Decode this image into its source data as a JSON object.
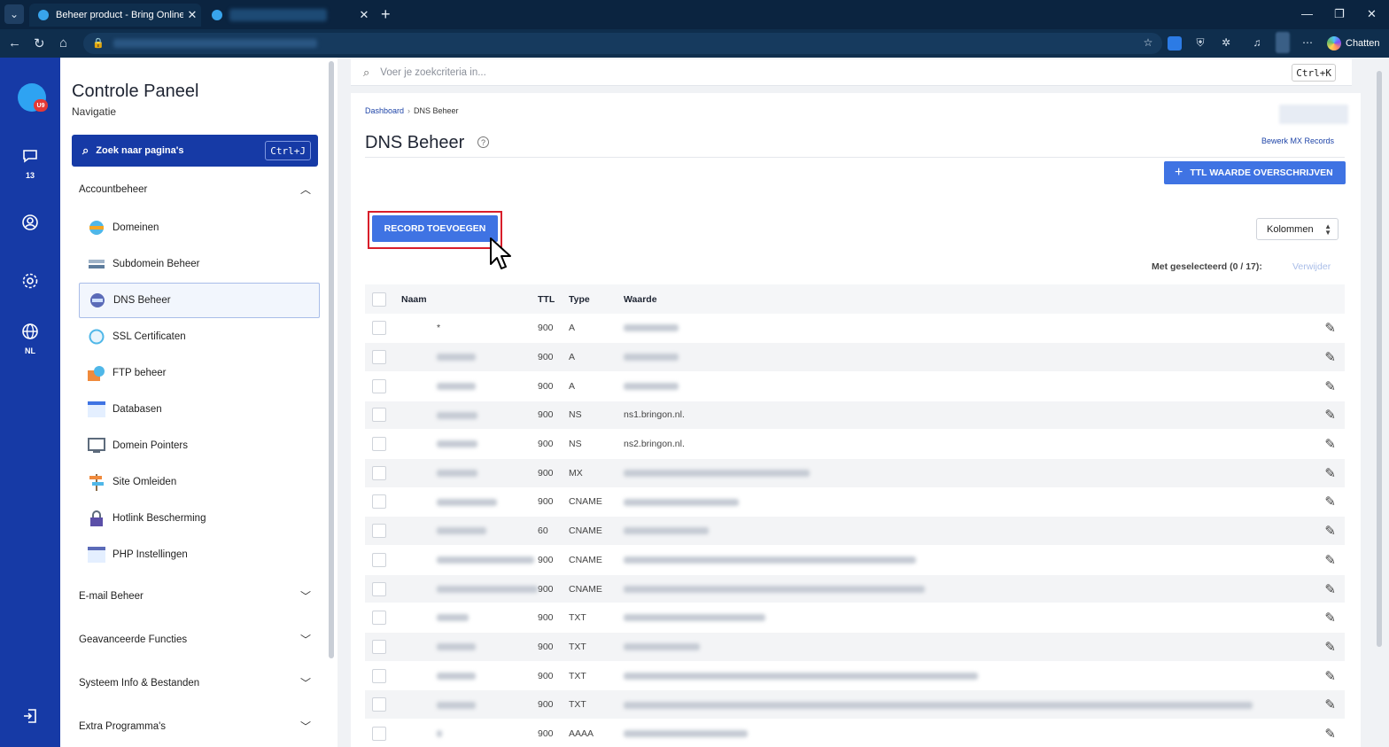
{
  "browser": {
    "active_tab_title": "Beheer product - Bring Online",
    "chatten_label": "Chatten"
  },
  "rail": {
    "badge": "U9",
    "chat_count": "13",
    "language": "NL"
  },
  "sidebar": {
    "title": "Controle Paneel",
    "subtitle": "Navigatie",
    "search_label": "Zoek naar pagina's",
    "search_shortcut": "Ctrl+J",
    "sections": [
      {
        "label": "Accountbeheer",
        "expanded": true
      },
      {
        "label": "E-mail Beheer",
        "expanded": false
      },
      {
        "label": "Geavanceerde Functies",
        "expanded": false
      },
      {
        "label": "Systeem Info & Bestanden",
        "expanded": false
      },
      {
        "label": "Extra Programma's",
        "expanded": false
      }
    ],
    "items": [
      {
        "label": "Domeinen",
        "icon": "globe-icon"
      },
      {
        "label": "Subdomein Beheer",
        "icon": "subdomain-icon"
      },
      {
        "label": "DNS Beheer",
        "icon": "dns-icon",
        "active": true
      },
      {
        "label": "SSL Certificaten",
        "icon": "certificate-icon"
      },
      {
        "label": "FTP beheer",
        "icon": "ftp-icon"
      },
      {
        "label": "Databasen",
        "icon": "database-icon"
      },
      {
        "label": "Domein Pointers",
        "icon": "pointer-icon"
      },
      {
        "label": "Site Omleiden",
        "icon": "signpost-icon"
      },
      {
        "label": "Hotlink Bescherming",
        "icon": "lock-icon"
      },
      {
        "label": "PHP Instellingen",
        "icon": "php-icon"
      }
    ]
  },
  "topsearch": {
    "placeholder": "Voer je zoekcriteria in...",
    "shortcut": "Ctrl+K"
  },
  "page": {
    "breadcrumb_home": "Dashboard",
    "breadcrumb_current": "DNS Beheer",
    "title": "DNS Beheer",
    "mx_link": "Bewerk MX Records",
    "ttl_button": "TTL WAARDE OVERSCHRIJVEN",
    "add_record_button": "RECORD TOEVOEGEN",
    "columns_button": "Kolommen",
    "selected_info": "Met geselecteerd (0 / 17):",
    "delete_link": "Verwijder"
  },
  "table": {
    "headers": {
      "name": "Naam",
      "ttl": "TTL",
      "type": "Type",
      "value": "Waarde"
    },
    "rows": [
      {
        "name": "*",
        "ttl": "900",
        "type": "A",
        "value": ""
      },
      {
        "name": "",
        "ttl": "900",
        "type": "A",
        "value": ""
      },
      {
        "name": "",
        "ttl": "900",
        "type": "A",
        "value": ""
      },
      {
        "name": "",
        "ttl": "900",
        "type": "NS",
        "value": "ns1.bringon.nl."
      },
      {
        "name": "",
        "ttl": "900",
        "type": "NS",
        "value": "ns2.bringon.nl."
      },
      {
        "name": "",
        "ttl": "900",
        "type": "MX",
        "value": ""
      },
      {
        "name": "",
        "ttl": "900",
        "type": "CNAME",
        "value": ""
      },
      {
        "name": "",
        "ttl": "60",
        "type": "CNAME",
        "value": ""
      },
      {
        "name": "",
        "ttl": "900",
        "type": "CNAME",
        "value": ""
      },
      {
        "name": "",
        "ttl": "900",
        "type": "CNAME",
        "value": ""
      },
      {
        "name": "",
        "ttl": "900",
        "type": "TXT",
        "value": ""
      },
      {
        "name": "",
        "ttl": "900",
        "type": "TXT",
        "value": ""
      },
      {
        "name": "",
        "ttl": "900",
        "type": "TXT",
        "value": ""
      },
      {
        "name": "",
        "ttl": "900",
        "type": "TXT",
        "value": ""
      },
      {
        "name": "",
        "ttl": "900",
        "type": "AAAA",
        "value": ""
      }
    ]
  },
  "colors": {
    "rail": "#163aa6",
    "primary_button": "#3f73e3",
    "highlight": "#d81e2a"
  }
}
